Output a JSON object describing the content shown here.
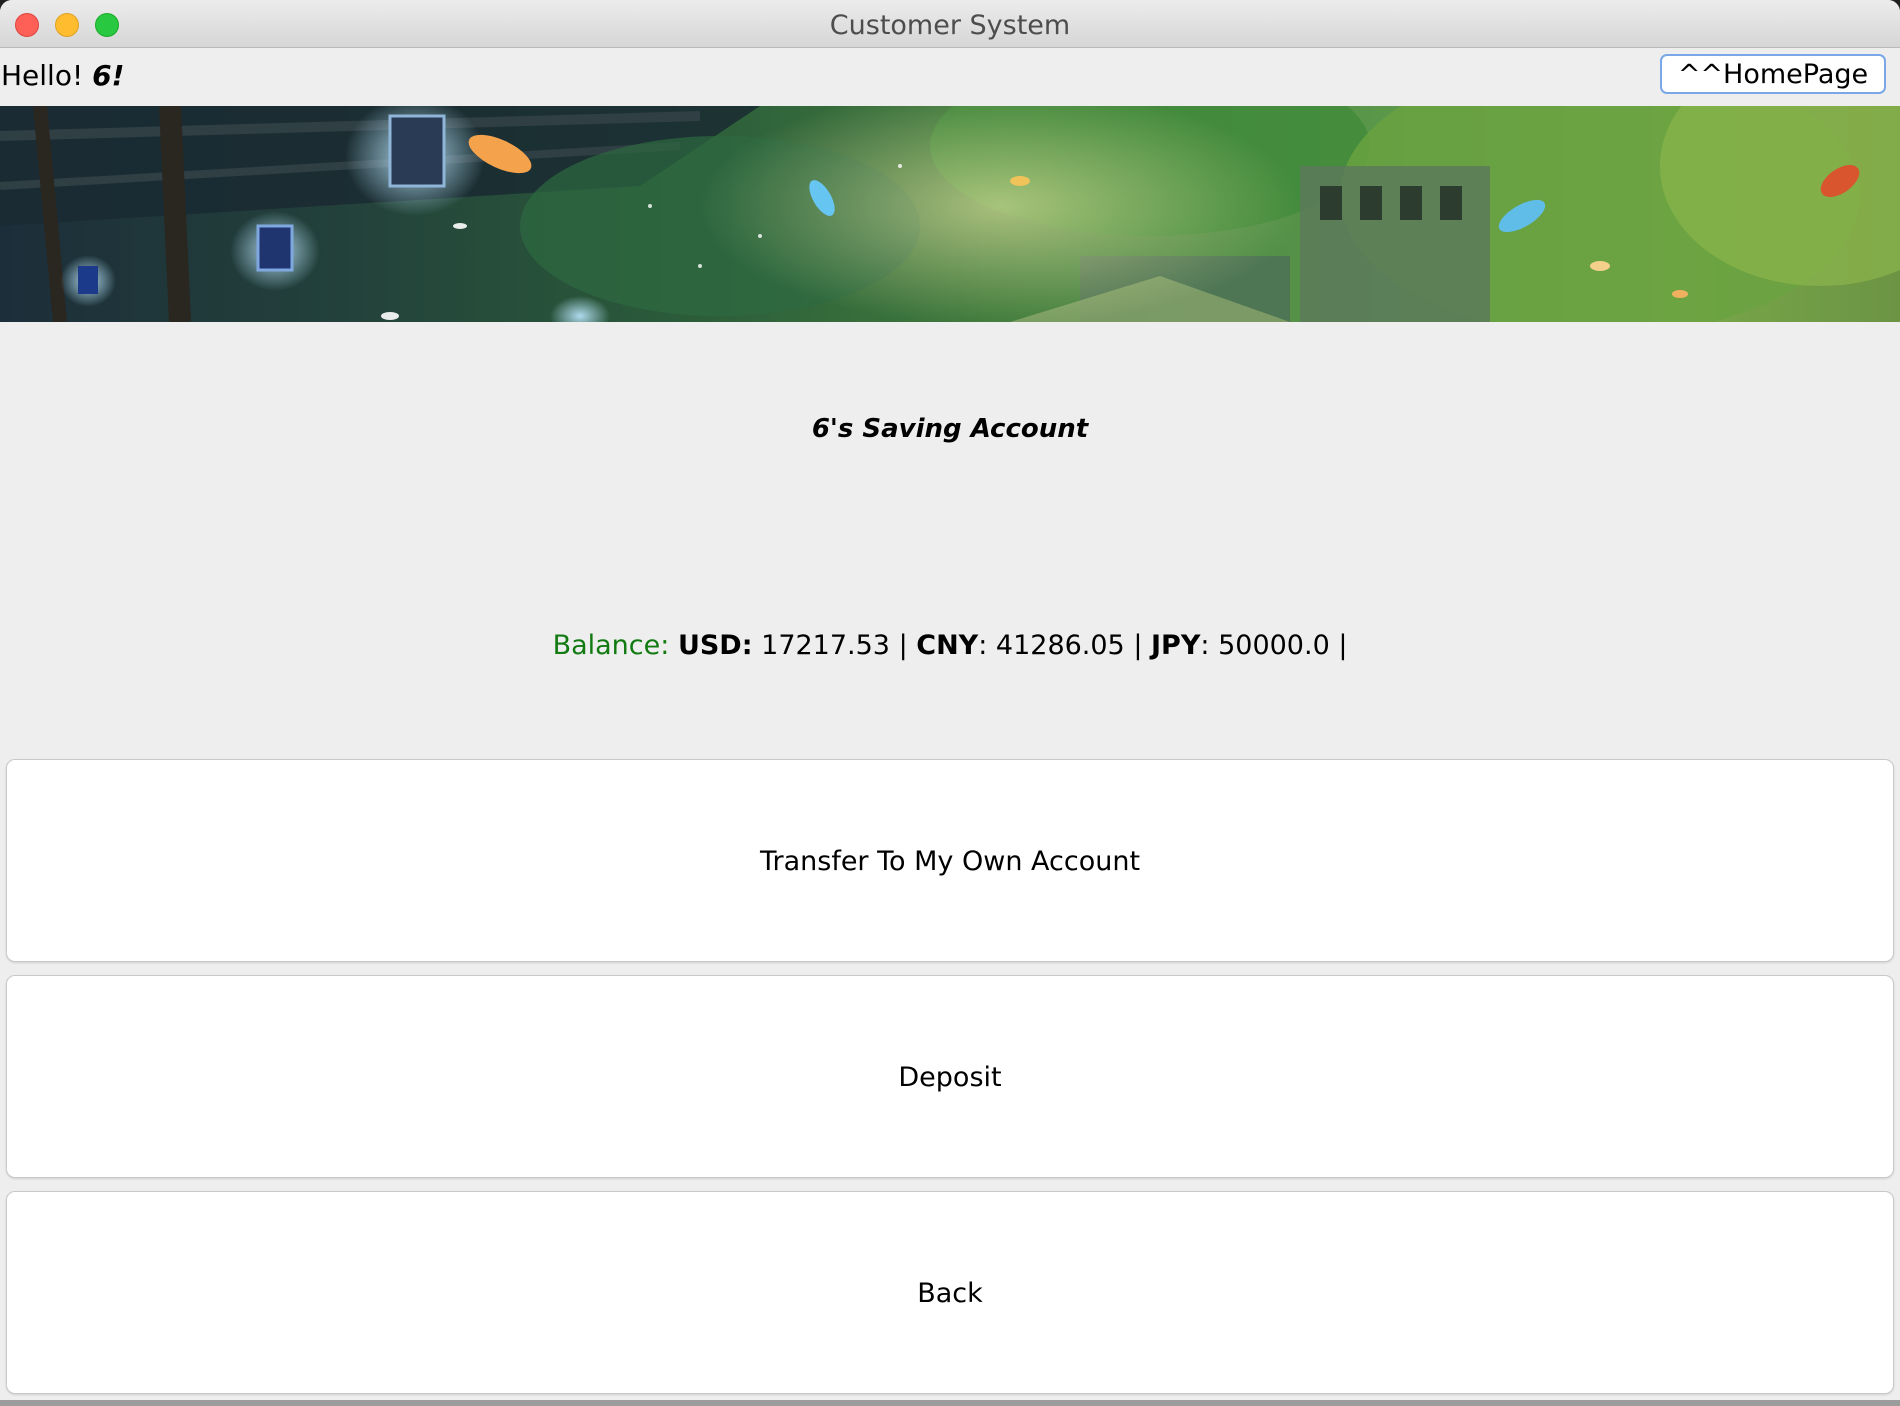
{
  "window": {
    "title": "Customer System"
  },
  "header": {
    "greeting_prefix": "Hello! ",
    "user_name": "6!",
    "homepage_button": "^^HomePage"
  },
  "account": {
    "title": "6's Saving Account",
    "balance_label": "Balance:",
    "balances": [
      {
        "currency": "USD",
        "value": "17217.53"
      },
      {
        "currency": "CNY",
        "value": "41286.05"
      },
      {
        "currency": "JPY",
        "value": "50000.0"
      }
    ]
  },
  "actions": {
    "transfer": "Transfer To My Own Account",
    "deposit": "Deposit",
    "back": "Back"
  },
  "colors": {
    "balance_label": "#117a11",
    "window_bg": "#eeeeee",
    "homepage_border": "#7aa7e8"
  }
}
